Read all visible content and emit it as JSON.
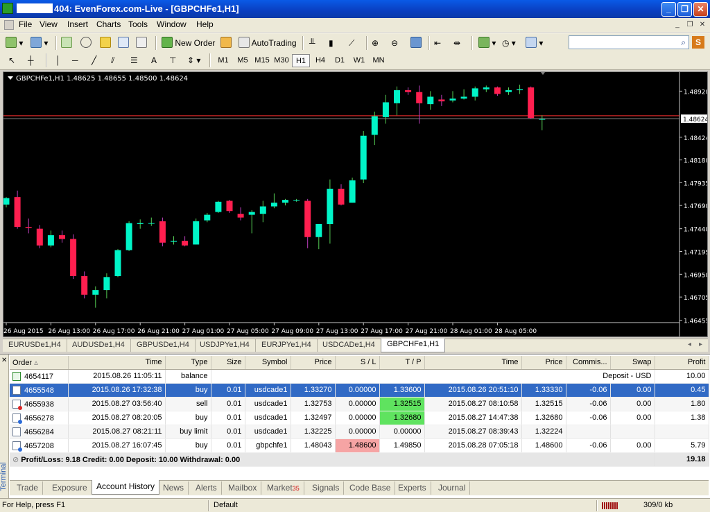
{
  "window": {
    "title": "404: EvenForex.com-Live - [GBPCHFe1,H1]"
  },
  "menu": [
    "File",
    "View",
    "Insert",
    "Charts",
    "Tools",
    "Window",
    "Help"
  ],
  "toolbar": {
    "new_order": "New Order",
    "autotrading": "AutoTrading",
    "line_label": "A"
  },
  "timeframes": [
    "M1",
    "M5",
    "M15",
    "M30",
    "H1",
    "H4",
    "D1",
    "W1",
    "MN"
  ],
  "active_timeframe": "H1",
  "chart": {
    "label": "GBPCHFe1,H1  1.48625 1.48655 1.48500 1.48624",
    "current_price": "1.48624"
  },
  "chart_data": {
    "type": "candlestick",
    "symbol": "GBPCHFe1",
    "timeframe": "H1",
    "ylim": [
      1.4643,
      1.4899
    ],
    "y_ticks": [
      "1.48920",
      "1.48424",
      "1.48180",
      "1.47935",
      "1.47690",
      "1.47440",
      "1.47195",
      "1.46950",
      "1.46705",
      "1.46455"
    ],
    "x_ticks": [
      "26 Aug 2015",
      "26 Aug 13:00",
      "26 Aug 17:00",
      "26 Aug 21:00",
      "27 Aug 01:00",
      "27 Aug 05:00",
      "27 Aug 09:00",
      "27 Aug 13:00",
      "27 Aug 17:00",
      "27 Aug 21:00",
      "28 Aug 01:00",
      "28 Aug 05:00"
    ],
    "bid_line": 1.48624,
    "ask_line": 1.48655,
    "candles": [
      [
        1.477,
        1.4778,
        1.4767,
        1.4777
      ],
      [
        1.4778,
        1.4785,
        1.4744,
        1.4746
      ],
      [
        1.4746,
        1.4755,
        1.4739,
        1.4745
      ],
      [
        1.4744,
        1.4748,
        1.4723,
        1.4726
      ],
      [
        1.4726,
        1.4742,
        1.4724,
        1.4737
      ],
      [
        1.4737,
        1.4742,
        1.4729,
        1.4733
      ],
      [
        1.4733,
        1.4738,
        1.469,
        1.4693
      ],
      [
        1.4693,
        1.4698,
        1.4669,
        1.4673
      ],
      [
        1.4673,
        1.4682,
        1.4659,
        1.4678
      ],
      [
        1.4678,
        1.4696,
        1.4669,
        1.4692
      ],
      [
        1.4693,
        1.4722,
        1.4692,
        1.4721
      ],
      [
        1.4721,
        1.4752,
        1.472,
        1.475
      ],
      [
        1.4749,
        1.4754,
        1.4744,
        1.475
      ],
      [
        1.475,
        1.4756,
        1.4747,
        1.475
      ],
      [
        1.4752,
        1.4756,
        1.4725,
        1.4729
      ],
      [
        1.473,
        1.4736,
        1.4727,
        1.4731
      ],
      [
        1.4731,
        1.4736,
        1.4725,
        1.4726
      ],
      [
        1.4727,
        1.4755,
        1.4727,
        1.4752
      ],
      [
        1.4753,
        1.4761,
        1.4751,
        1.4759
      ],
      [
        1.4762,
        1.4774,
        1.4761,
        1.4773
      ],
      [
        1.4774,
        1.4775,
        1.4761,
        1.4763
      ],
      [
        1.476,
        1.4767,
        1.4753,
        1.4756
      ],
      [
        1.4759,
        1.4764,
        1.4739,
        1.4762
      ],
      [
        1.476,
        1.4774,
        1.4751,
        1.4768
      ],
      [
        1.4768,
        1.4782,
        1.4766,
        1.4772
      ],
      [
        1.4772,
        1.4776,
        1.4769,
        1.4775
      ],
      [
        1.4775,
        1.4776,
        1.4773,
        1.4775
      ],
      [
        1.4774,
        1.4776,
        1.4723,
        1.4735
      ],
      [
        1.4735,
        1.4748,
        1.4722,
        1.4749
      ],
      [
        1.4749,
        1.4797,
        1.4728,
        1.4787
      ],
      [
        1.4787,
        1.4792,
        1.4769,
        1.477
      ],
      [
        1.4772,
        1.4799,
        1.4772,
        1.4796
      ],
      [
        1.4797,
        1.4849,
        1.4793,
        1.4844
      ],
      [
        1.4845,
        1.487,
        1.4834,
        1.4865
      ],
      [
        1.4864,
        1.4888,
        1.4857,
        1.488
      ],
      [
        1.4879,
        1.4897,
        1.4866,
        1.4893
      ],
      [
        1.4893,
        1.4896,
        1.4888,
        1.4891
      ],
      [
        1.4891,
        1.4898,
        1.4857,
        1.4879
      ],
      [
        1.4878,
        1.4892,
        1.4872,
        1.4886
      ],
      [
        1.4883,
        1.4888,
        1.4876,
        1.4881
      ],
      [
        1.4882,
        1.4892,
        1.488,
        1.4884
      ],
      [
        1.4884,
        1.4894,
        1.4883,
        1.4886
      ],
      [
        1.4886,
        1.4897,
        1.4882,
        1.4895
      ],
      [
        1.4894,
        1.4898,
        1.4891,
        1.4896
      ],
      [
        1.4896,
        1.4897,
        1.4887,
        1.4889
      ],
      [
        1.4891,
        1.4896,
        1.4888,
        1.4893
      ],
      [
        1.4893,
        1.4899,
        1.4889,
        1.4894
      ],
      [
        1.4896,
        1.4897,
        1.4862,
        1.4863
      ],
      [
        1.4862,
        1.4866,
        1.485,
        1.4862
      ]
    ],
    "bull_color": "#00f5c8",
    "bear_color": "#ff1f4f"
  },
  "chart_tabs": [
    "EURUSDe1,H4",
    "AUDUSDe1,H4",
    "GBPUSDe1,H4",
    "USDJPYe1,H4",
    "EURJPYe1,H4",
    "USDCADe1,H4",
    "GBPCHFe1,H1"
  ],
  "active_chart_tab": "GBPCHFe1,H1",
  "terminal": {
    "side_label": "Terminal",
    "columns": [
      "Order",
      "Time",
      "Type",
      "Size",
      "Symbol",
      "Price",
      "S / L",
      "T / P",
      "Time",
      "Price",
      "Commis...",
      "Swap",
      "Profit"
    ],
    "rows": [
      {
        "order": "4654117",
        "time": "2015.08.26 11:05:11",
        "type": "balance",
        "size": "",
        "symbol": "",
        "price": "",
        "sl": "",
        "tp": "",
        "close_time": "",
        "close_price": "",
        "commission": "",
        "swap": "Deposit - USD",
        "profit": "10.00"
      },
      {
        "order": "4655548",
        "time": "2015.08.26 17:32:38",
        "type": "buy",
        "size": "0.01",
        "symbol": "usdcade1",
        "price": "1.33270",
        "sl": "0.00000",
        "tp": "1.33600",
        "close_time": "2015.08.26 20:51:10",
        "close_price": "1.33330",
        "commission": "-0.06",
        "swap": "0.00",
        "profit": "0.45"
      },
      {
        "order": "4655938",
        "time": "2015.08.27 03:56:40",
        "type": "sell",
        "size": "0.01",
        "symbol": "usdcade1",
        "price": "1.32753",
        "sl": "0.00000",
        "tp": "1.32515",
        "close_time": "2015.08.27 08:10:58",
        "close_price": "1.32515",
        "commission": "-0.06",
        "swap": "0.00",
        "profit": "1.80"
      },
      {
        "order": "4656278",
        "time": "2015.08.27 08:20:05",
        "type": "buy",
        "size": "0.01",
        "symbol": "usdcade1",
        "price": "1.32497",
        "sl": "0.00000",
        "tp": "1.32680",
        "close_time": "2015.08.27 14:47:38",
        "close_price": "1.32680",
        "commission": "-0.06",
        "swap": "0.00",
        "profit": "1.38"
      },
      {
        "order": "4656284",
        "time": "2015.08.27 08:21:11",
        "type": "buy limit",
        "size": "0.01",
        "symbol": "usdcade1",
        "price": "1.32225",
        "sl": "0.00000",
        "tp": "0.00000",
        "close_time": "2015.08.27 08:39:43",
        "close_price": "1.32224",
        "commission": "",
        "swap": "",
        "profit": ""
      },
      {
        "order": "4657208",
        "time": "2015.08.27 16:07:45",
        "type": "buy",
        "size": "0.01",
        "symbol": "gbpchfe1",
        "price": "1.48043",
        "sl": "1.48600",
        "tp": "1.49850",
        "close_time": "2015.08.28 07:05:18",
        "close_price": "1.48600",
        "commission": "-0.06",
        "swap": "0.00",
        "profit": "5.79"
      }
    ],
    "summary": {
      "text": "Profit/Loss: 9.18  Credit: 0.00  Deposit: 10.00  Withdrawal: 0.00",
      "total": "19.18"
    }
  },
  "bottom_tabs": [
    "Trade",
    "Exposure",
    "Account History",
    "News",
    "Alerts",
    "Mailbox",
    "Market",
    "Signals",
    "Code Base",
    "Experts",
    "Journal"
  ],
  "market_badge": "35",
  "active_bottom_tab": "Account History",
  "status": {
    "help": "For Help, press F1",
    "profile": "Default",
    "traffic": "309/0 kb"
  }
}
